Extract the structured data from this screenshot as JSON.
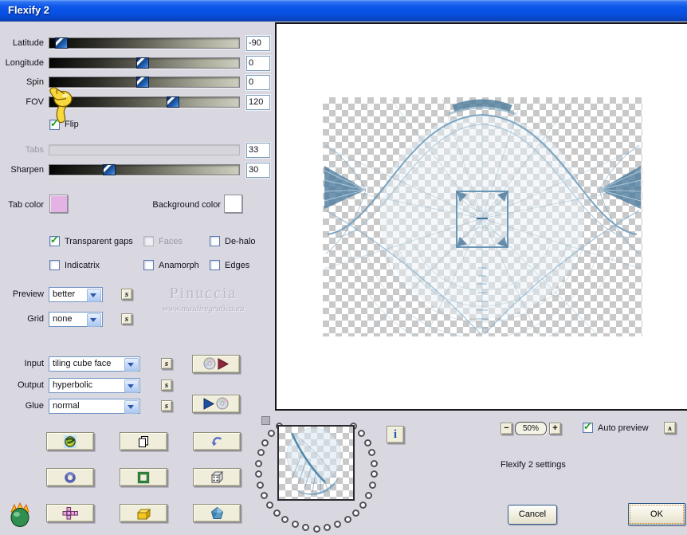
{
  "window": {
    "title": "Flexify 2"
  },
  "icons": {
    "checkmark": "✓",
    "s_label": "s",
    "info": "i",
    "minus": "−",
    "plus": "+",
    "collapse": "∧"
  },
  "panel": {
    "sliders": [
      {
        "label": "Latitude",
        "value": "-90",
        "fraction": 0.03,
        "disabled": false
      },
      {
        "label": "Longitude",
        "value": "0",
        "fraction": 0.49,
        "disabled": false
      },
      {
        "label": "Spin",
        "value": "0",
        "fraction": 0.49,
        "disabled": false
      },
      {
        "label": "FOV",
        "value": "120",
        "fraction": 0.66,
        "disabled": false
      },
      {
        "label": "Tabs",
        "value": "33",
        "fraction": null,
        "disabled": true
      },
      {
        "label": "Sharpen",
        "value": "30",
        "fraction": 0.3,
        "disabled": false
      }
    ],
    "flip": {
      "label": "Flip",
      "checked": true
    },
    "tab_color": {
      "label": "Tab color",
      "color": "#e3b4e3"
    },
    "background_color": {
      "label": "Background color",
      "color": "#ffffff"
    },
    "options": [
      {
        "label": "Transparent gaps",
        "checked": true,
        "disabled": false
      },
      {
        "label": "Faces",
        "checked": false,
        "disabled": true
      },
      {
        "label": "De-halo",
        "checked": false,
        "disabled": false
      },
      {
        "label": "Indicatrix",
        "checked": false,
        "disabled": false
      },
      {
        "label": "Anamorph",
        "checked": false,
        "disabled": false
      },
      {
        "label": "Edges",
        "checked": false,
        "disabled": false
      }
    ],
    "dropdowns": [
      {
        "label": "Preview",
        "value": "better"
      },
      {
        "label": "Grid",
        "value": "none"
      },
      {
        "label": "Input",
        "value": "tiling cube face"
      },
      {
        "label": "Output",
        "value": "hyperbolic"
      },
      {
        "label": "Glue",
        "value": "normal"
      }
    ]
  },
  "watermark": {
    "line1": "Pinuccia",
    "line2": "www.maidiregrafica.eu"
  },
  "footer": {
    "zoom_level": "50%",
    "auto_preview": {
      "label": "Auto preview",
      "checked": true
    },
    "status_text": "Flexify 2 settings",
    "cancel_label": "Cancel",
    "ok_label": "OK"
  }
}
